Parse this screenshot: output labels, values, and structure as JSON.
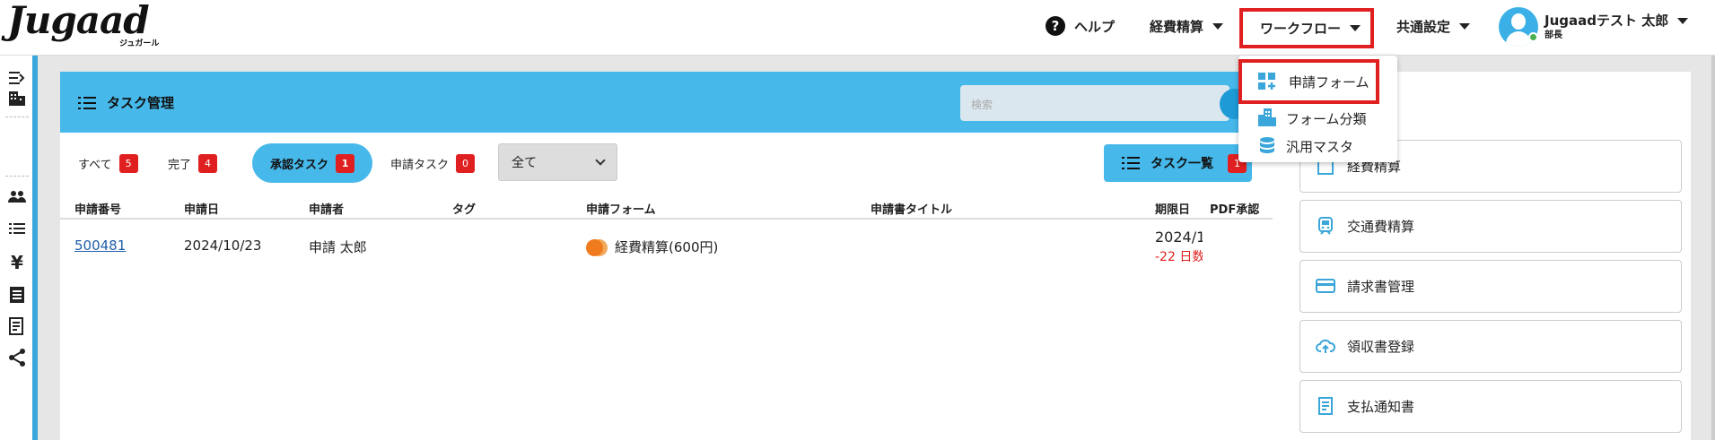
{
  "brand": {
    "name": "Jugaad",
    "subtitle": "ジュガール"
  },
  "header": {
    "help_label": "ヘルプ",
    "expense_label": "経費精算",
    "workflow_label": "ワークフロー",
    "common_settings_label": "共通設定",
    "user_name": "Jugaadテスト 太郎",
    "user_role": "部長"
  },
  "workflow_menu": {
    "items": [
      {
        "label": "申請フォーム",
        "icon": "form-grid-icon",
        "highlighted": true
      },
      {
        "label": "フォーム分類",
        "icon": "building-icon",
        "highlighted": false
      },
      {
        "label": "汎用マスタ",
        "icon": "database-icon",
        "highlighted": false
      }
    ]
  },
  "sidebar": {
    "icons": [
      "expand-icon",
      "building-icon",
      "users-icon",
      "list-icon",
      "yen-icon",
      "receipt-icon",
      "invoice-icon",
      "share-icon"
    ]
  },
  "task_panel": {
    "title": "タスク管理",
    "search_placeholder": "検索",
    "tabs": [
      {
        "label": "すべて",
        "count": "5",
        "active": false
      },
      {
        "label": "完了",
        "count": "4",
        "active": false
      },
      {
        "label": "承認タスク",
        "count": "1",
        "active": true
      },
      {
        "label": "申請タスク",
        "count": "0",
        "active": false
      }
    ],
    "filter_selected": "全て",
    "task_list_button": {
      "label": "タスク一覧",
      "count": "1"
    },
    "columns": [
      "申請番号",
      "申請日",
      "申請者",
      "タグ",
      "申請フォーム",
      "申請書タイトル",
      "期限日",
      "PDF承認"
    ],
    "rows": [
      {
        "number": "500481",
        "date": "2024/10/23",
        "applicant": "申請 太郎",
        "tag": "",
        "form": "経費精算(600円)",
        "title": "",
        "due_date": "2024/1",
        "due_remaining": "-22 日数",
        "pdf": ""
      }
    ]
  },
  "right_panel": {
    "items": [
      {
        "label": "経費精算",
        "icon": "receipt-icon"
      },
      {
        "label": "交通費精算",
        "icon": "train-icon"
      },
      {
        "label": "請求書管理",
        "icon": "card-icon"
      },
      {
        "label": "領収書登録",
        "icon": "cloud-upload-icon"
      },
      {
        "label": "支払通知書",
        "icon": "document-icon"
      }
    ]
  },
  "colors": {
    "accent": "#46b8ea",
    "badge": "#e02020",
    "highlight_border": "#e02020",
    "link": "#1f5fa8"
  }
}
